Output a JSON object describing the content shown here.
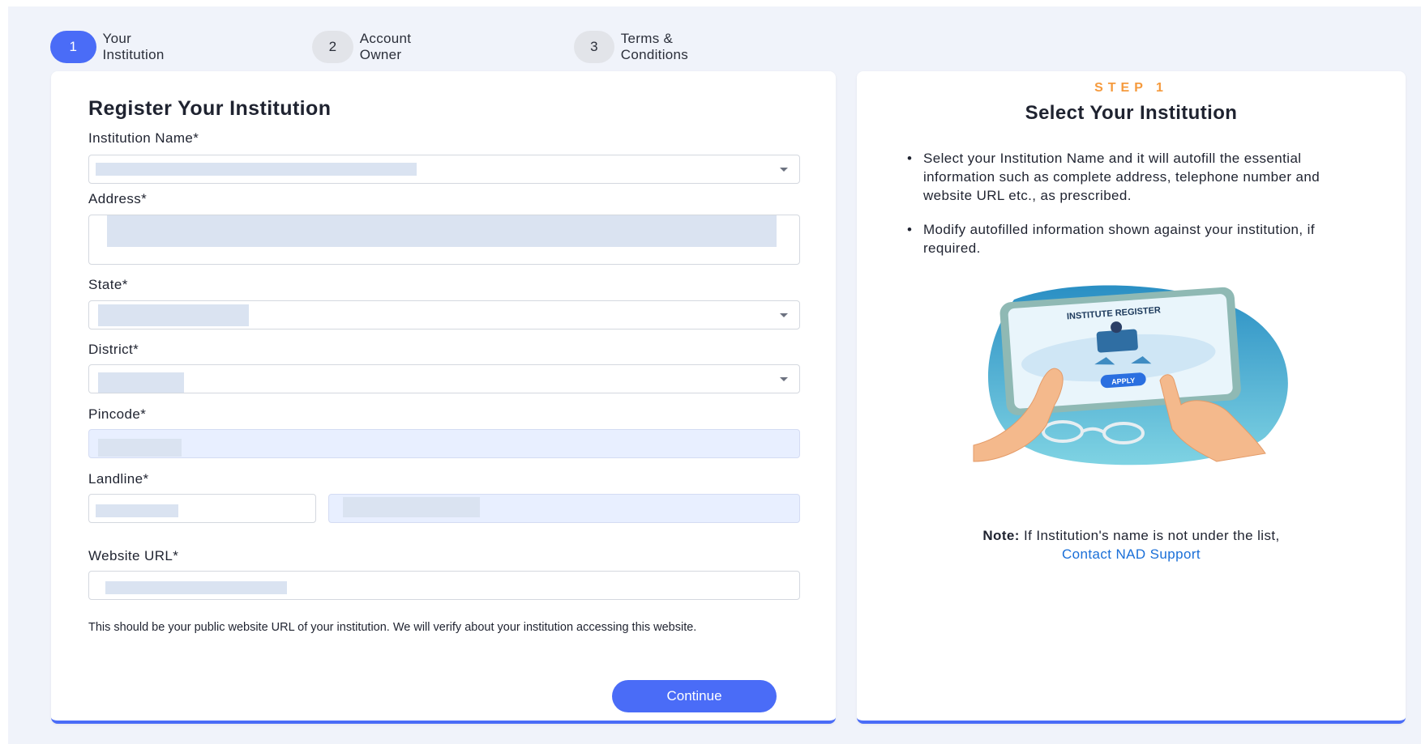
{
  "stepper": {
    "steps": [
      {
        "number": "1",
        "label": "Your Institution",
        "active": true
      },
      {
        "number": "2",
        "label": "Account Owner",
        "active": false
      },
      {
        "number": "3",
        "label": "Terms & Conditions",
        "active": false
      }
    ]
  },
  "form": {
    "title": "Register Your Institution",
    "institution_name_label": "Institution Name*",
    "address_label": "Address*",
    "state_label": "State*",
    "district_label": "District*",
    "pincode_label": "Pincode*",
    "landline_label": "Landline*",
    "website_label": "Website URL*",
    "hint": "This should be your public website URL of your institution. We will verify about your institution accessing this website.",
    "continue_label": "Continue"
  },
  "info": {
    "eyebrow": "STEP 1",
    "title": "Select Your Institution",
    "bullets": [
      "Select your Institution Name and it will autofill the essential information such as complete address, telephone number and website URL etc., as prescribed.",
      "Modify autofilled information shown against your institution, if required."
    ],
    "illustration": {
      "title": "INSTITUTE REGISTER",
      "button": "APPLY"
    },
    "note_label": "Note:",
    "note_text": " If Institution's name is not under the list,",
    "note_link": "Contact NAD Support"
  },
  "colors": {
    "accent": "#4a6cf7",
    "eyebrow": "#f59a3d",
    "link": "#1a6fd8"
  }
}
